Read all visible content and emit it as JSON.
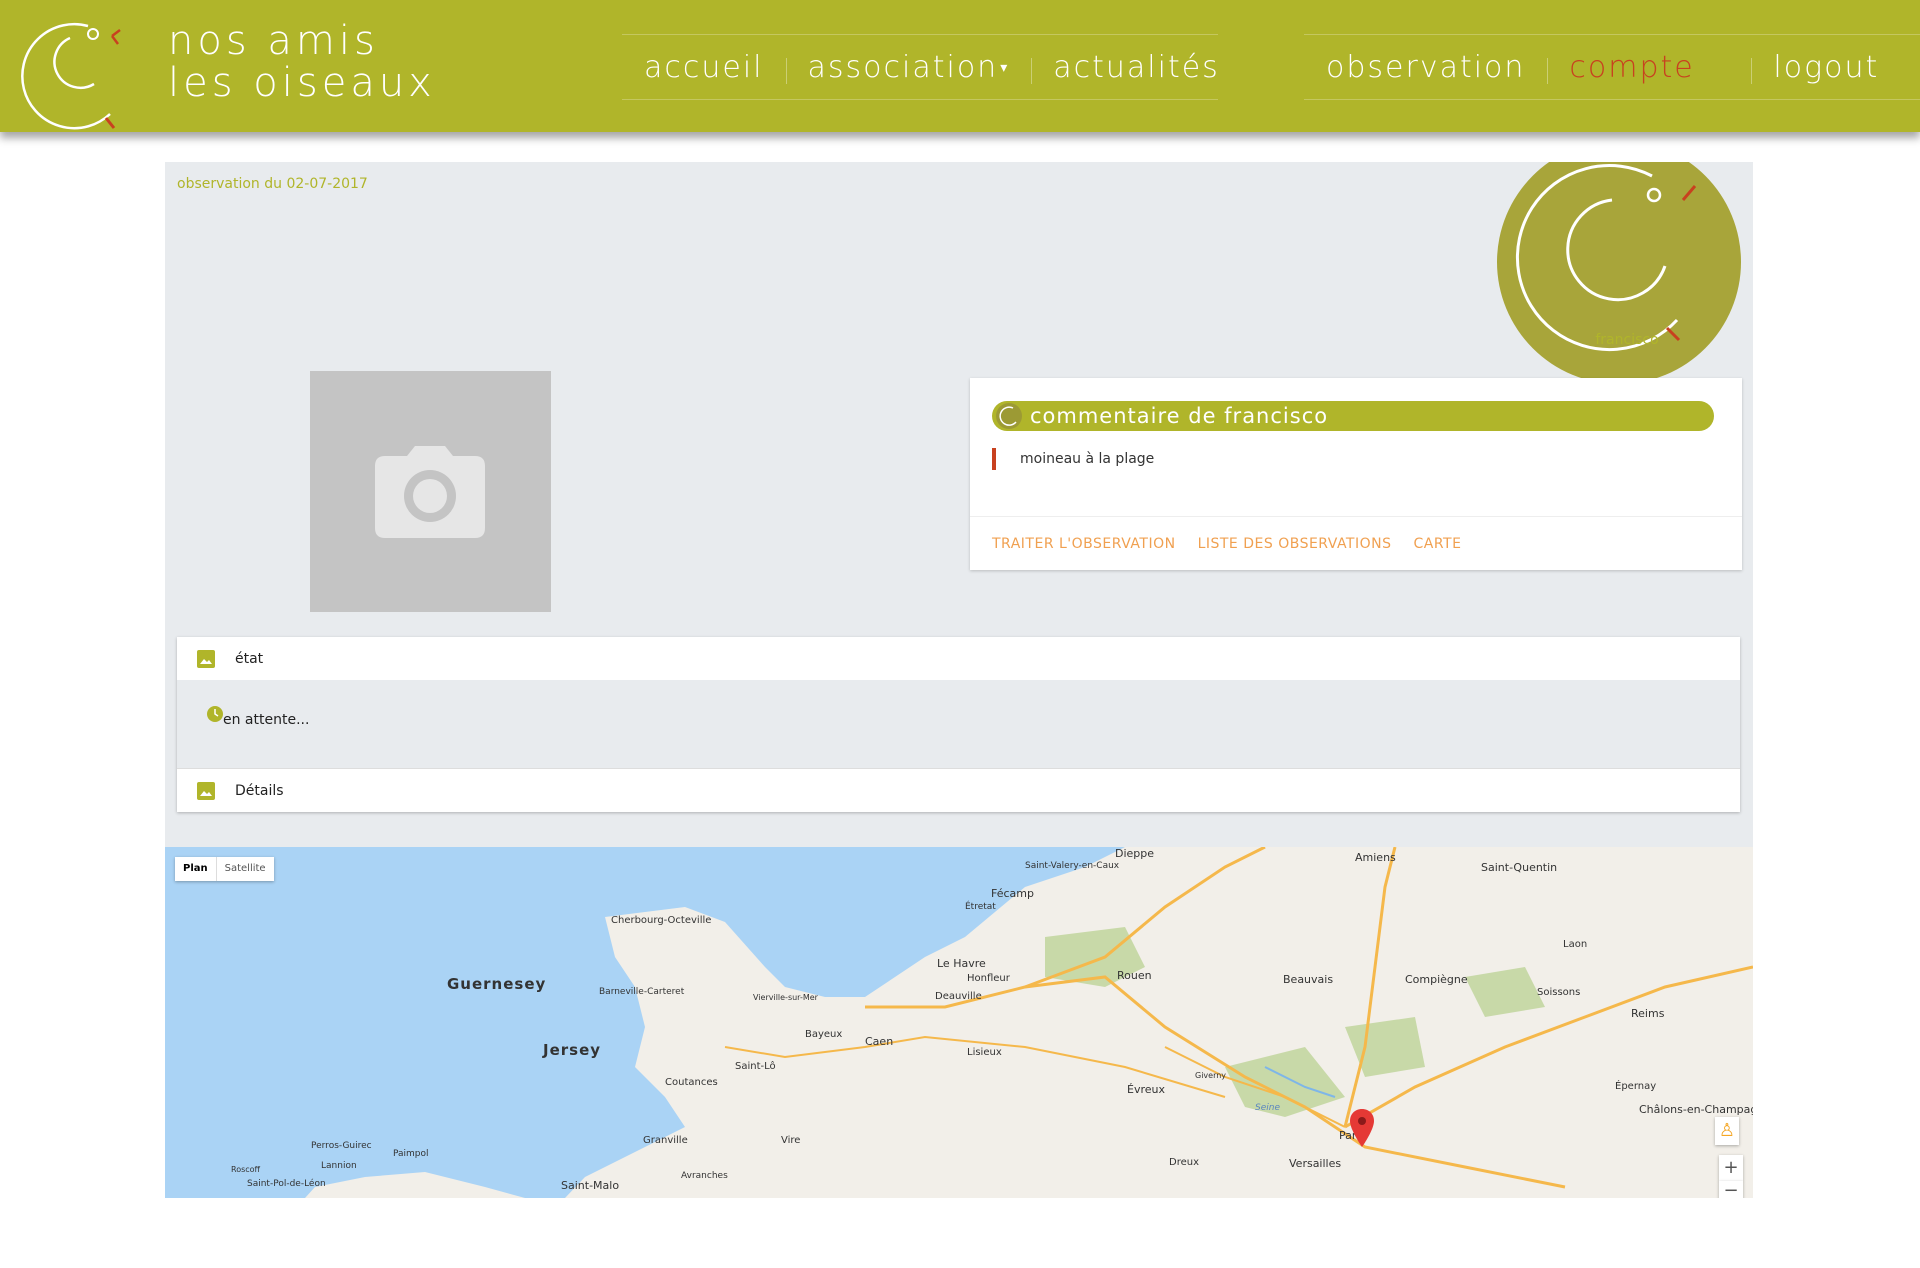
{
  "header": {
    "logo_line1": "nos amis",
    "logo_line2": "les oiseaux",
    "nav_left": [
      "accueil",
      "association",
      "actualités"
    ],
    "nav_right": [
      "observation",
      "compte",
      "logout"
    ],
    "active": "compte"
  },
  "observation": {
    "date_label": "observation du 02-07-2017",
    "author": "francisco"
  },
  "comment": {
    "title": "commentaire de francisco",
    "text": "moineau à la plage",
    "actions": [
      "TRAITER L'OBSERVATION",
      "LISTE DES OBSERVATIONS",
      "CARTE"
    ]
  },
  "accordion": {
    "etat_label": "état",
    "etat_value": "en attente...",
    "details_label": "Détails"
  },
  "map": {
    "toggle": [
      "Plan",
      "Satellite"
    ],
    "places": [
      "Dieppe",
      "Amiens",
      "Saint-Quentin",
      "Saint-Valery-en-Caux",
      "Fécamp",
      "Étretat",
      "Cherbourg-Octeville",
      "Le Havre",
      "Honfleur",
      "Deauville",
      "Rouen",
      "Beauvais",
      "Compiègne",
      "Laon",
      "Soissons",
      "Reims",
      "Guernesey",
      "Jersey",
      "Barneville-Carteret",
      "Bayeux",
      "Caen",
      "Lisieux",
      "Saint-Lô",
      "Coutances",
      "Évreux",
      "Granville",
      "Vire",
      "Perros-Guirec",
      "Paimpol",
      "Lannion",
      "Roscoff",
      "Saint-Pol-de-Léon",
      "Saint-Malo",
      "Avranches",
      "Dreux",
      "Versailles",
      "Paris",
      "Épernay",
      "Châlons-en-Champagne",
      "Seine",
      "Giverny",
      "Vierville-sur-Mer"
    ],
    "colors": {
      "water": "#aad3f5",
      "land": "#f2efe9",
      "road": "#f5b84b",
      "forest": "#c8d9a8"
    }
  },
  "colors": {
    "brand": "#b0b52a",
    "accent": "#c8411f",
    "action": "#f0a050"
  }
}
